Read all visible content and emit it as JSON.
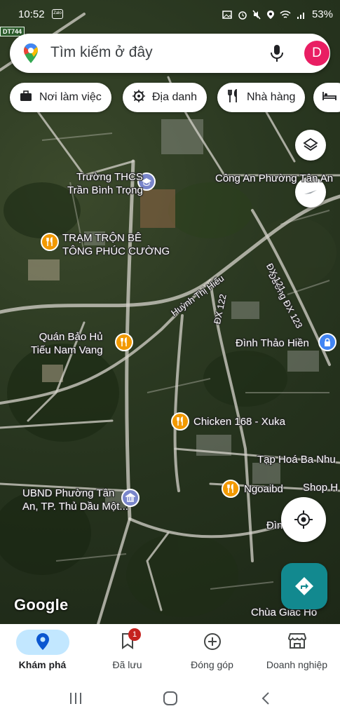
{
  "status_bar": {
    "time": "10:52",
    "battery": "53%",
    "notification_label": "Zalo"
  },
  "map": {
    "road_shield": "DT744",
    "labels": {
      "school": [
        "Trường THCS",
        "Trần Bình Trọng"
      ],
      "police": "Công An Phường Tân An",
      "batching_plant": [
        "TRẠM TRỘN BÊ",
        "TÔNG PHÚC CƯỜNG"
      ],
      "road_dx123": "Đường ĐX 123",
      "road_dx121": "ĐX 121",
      "road_huynh": "Huỳnh Thị Hiếu",
      "road_dx122": "ĐX 122",
      "restaurant_quan": [
        "Quán Bảo Hủ",
        "Tiếu Nam Vang"
      ],
      "temple": "Đình Thảo Hiền",
      "chicken": "Chicken 168 - Xuka",
      "grocery": "Tạp Hoá Ba Nhu",
      "shop": "Shop H",
      "ngoaibd": "Ngoaibd",
      "ubnd": [
        "UBND Phường Tân",
        "An, TP. Thủ Dầu Một..."
      ],
      "dinh_partial": "Đìn",
      "pagoda": "Chùa Giác Ho"
    },
    "watermark": "Google"
  },
  "search": {
    "placeholder": "Tìm kiếm ở đây",
    "avatar_letter": "D"
  },
  "chips": [
    {
      "label": "Nơi làm việc",
      "icon": "briefcase-icon"
    },
    {
      "label": "Địa danh",
      "icon": "landmark-icon"
    },
    {
      "label": "Nhà hàng",
      "icon": "restaurant-icon"
    },
    {
      "label": "",
      "icon": "hotel-icon"
    }
  ],
  "bottom_nav": {
    "items": [
      {
        "label": "Khám phá",
        "icon": "explore-icon",
        "active": true
      },
      {
        "label": "Đã lưu",
        "icon": "bookmark-icon",
        "badge": "1"
      },
      {
        "label": "Đóng góp",
        "icon": "add-circle-icon"
      },
      {
        "label": "Doanh nghiệp",
        "icon": "storefront-icon"
      }
    ]
  },
  "colors": {
    "accent": "#12898f",
    "active_pill": "#c2e7ff",
    "food_poi": "#f29900",
    "avatar": "#e91e63"
  }
}
